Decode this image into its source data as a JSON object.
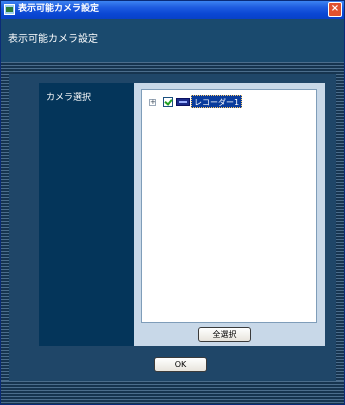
{
  "window": {
    "title": "表示可能カメラ設定",
    "close_glyph": "×",
    "app_icon": "app-icon"
  },
  "header": {
    "heading": "表示可能カメラ設定"
  },
  "panel": {
    "label": "カメラ選択",
    "tree": [
      {
        "expander": "+",
        "checked": true,
        "icon": "recorder-icon",
        "label": "レコーダー1"
      }
    ],
    "select_all_label": "全選択"
  },
  "footer": {
    "ok_label": "OK"
  },
  "colors": {
    "titlebar": "#0a47d4",
    "body": "#1d3d5a",
    "label_column": "#04355a",
    "selection": "#0a3c9c",
    "check": "#21a121",
    "close": "#e0512f"
  }
}
